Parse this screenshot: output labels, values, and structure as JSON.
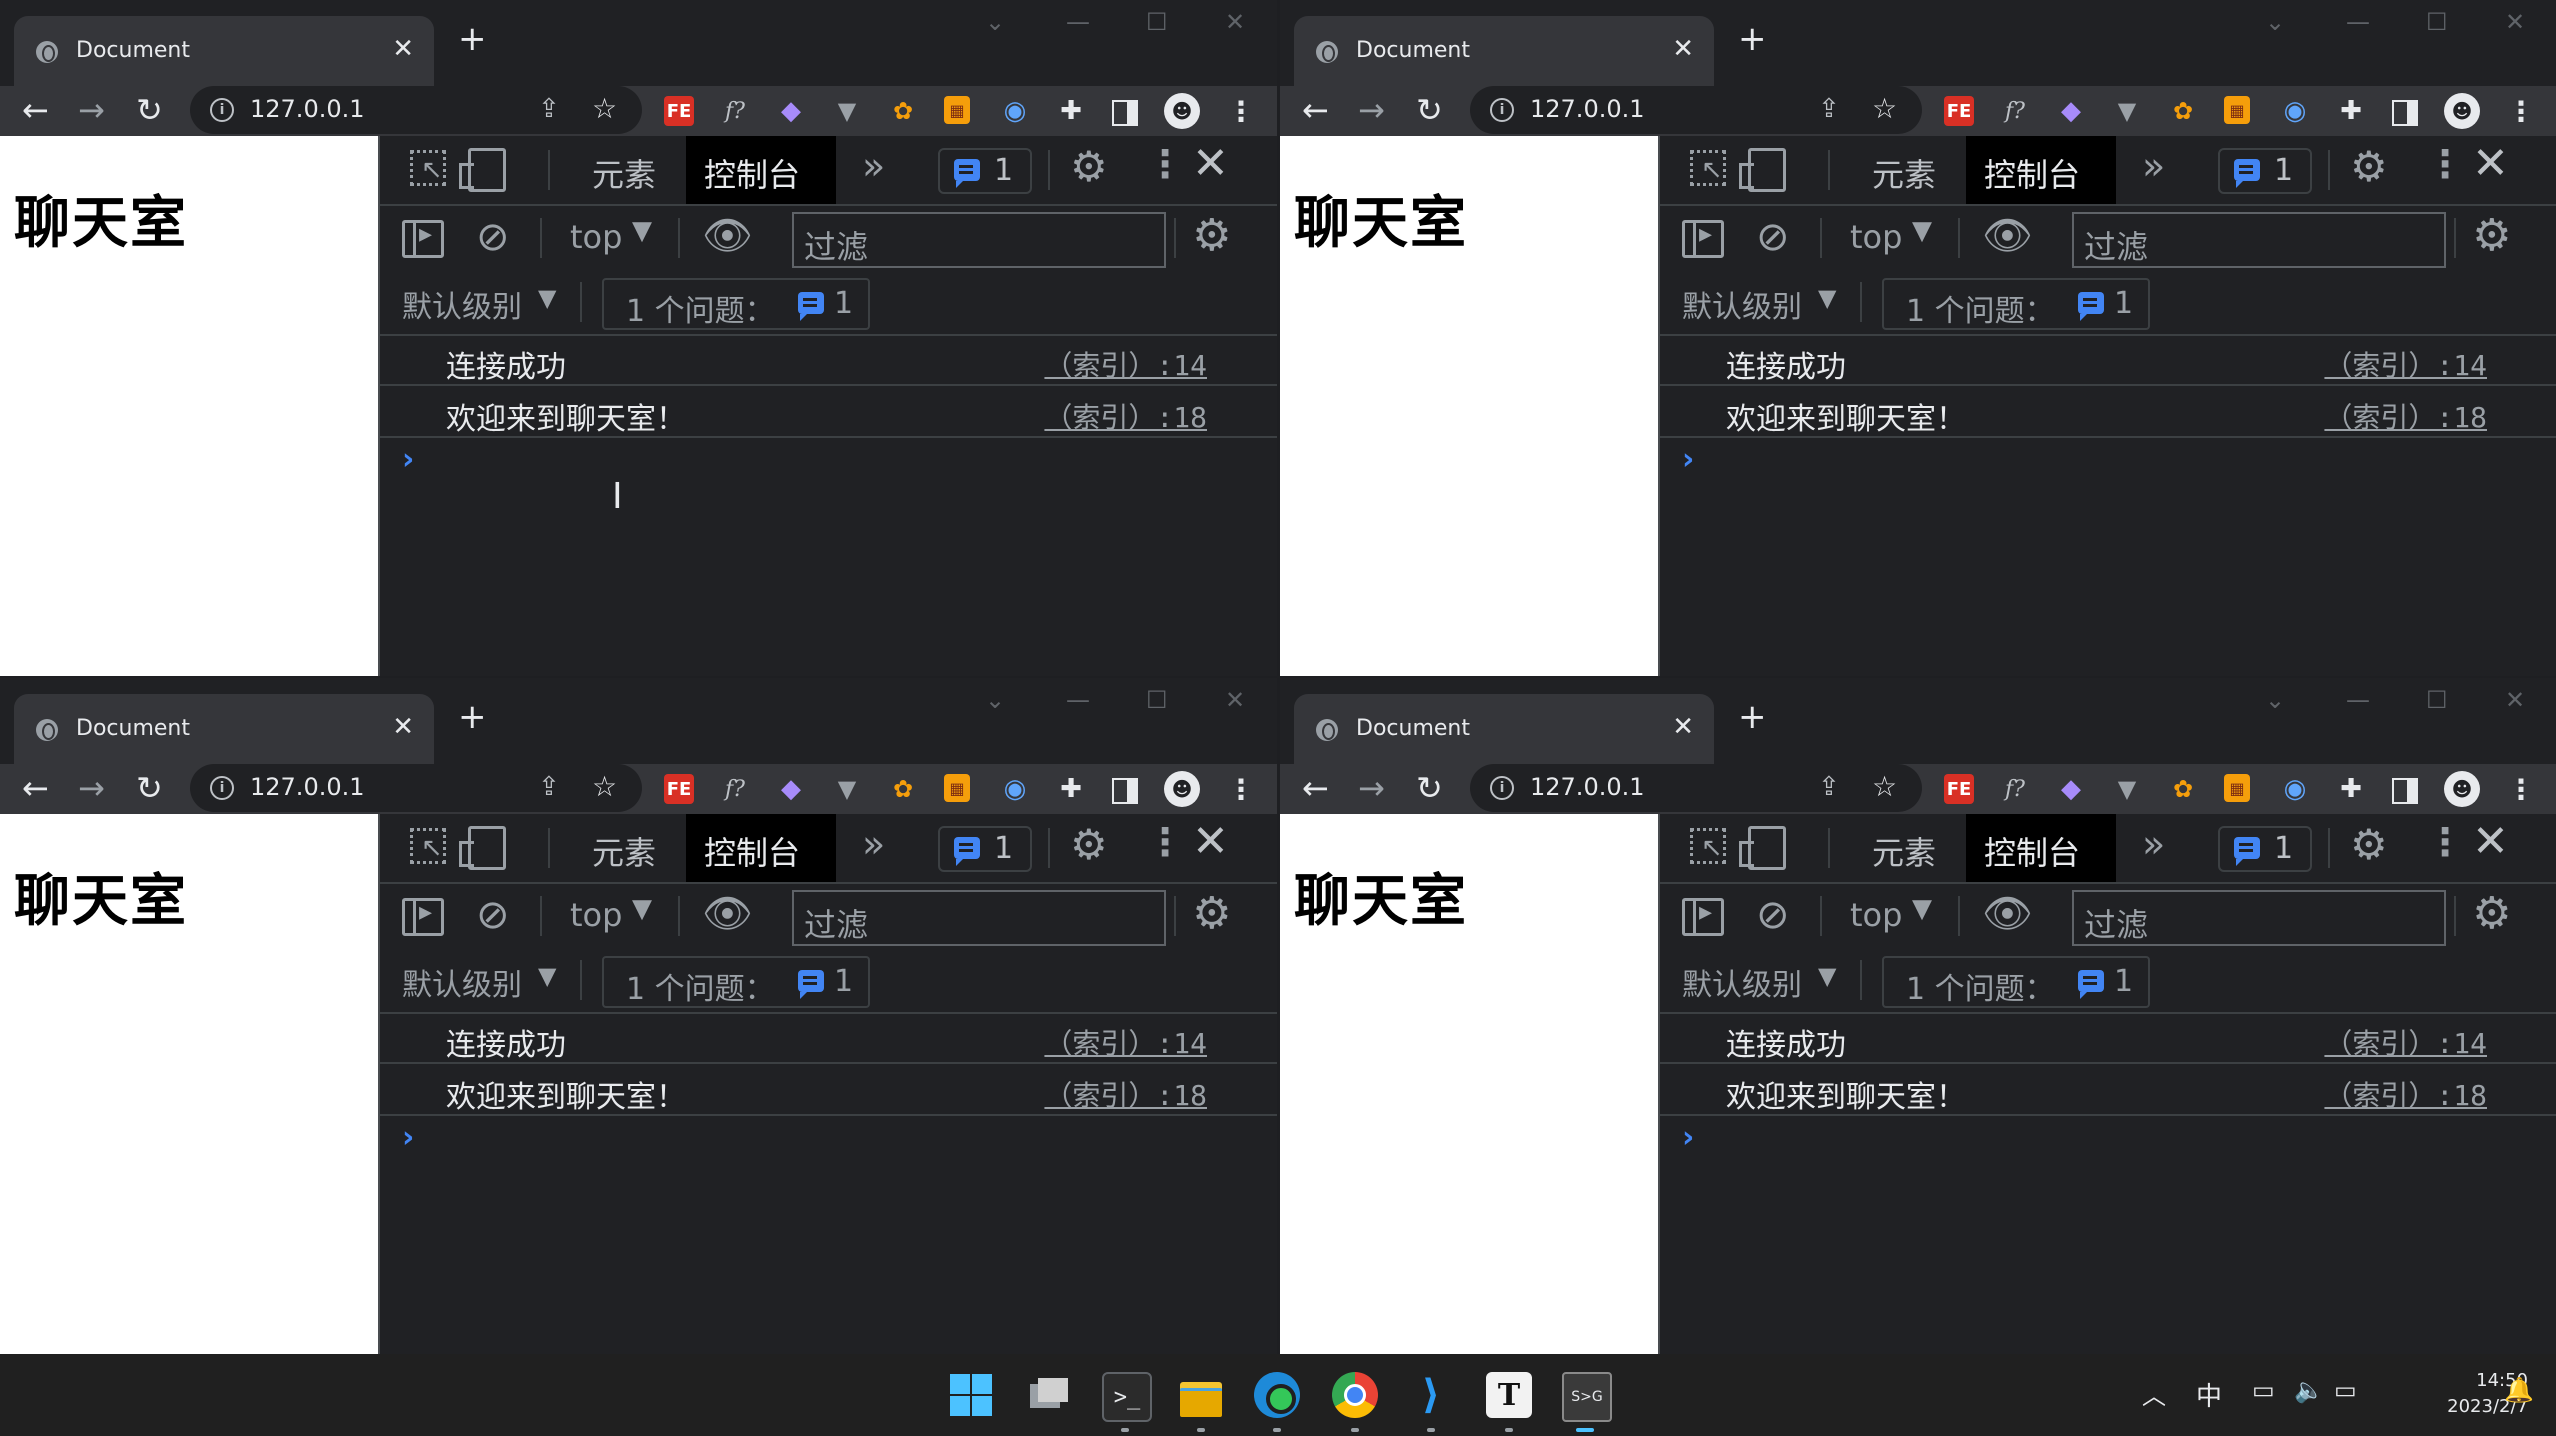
{
  "browser": {
    "tab_title": "Document",
    "tab_close": "✕",
    "new_tab": "+",
    "url": "127.0.0.1",
    "extensions": [
      "FE",
      "f?",
      "palette",
      "vue",
      "cookie",
      "calc",
      "fire",
      "puzzle",
      "sidepanel",
      "avatar",
      "menu"
    ]
  },
  "page": {
    "heading": "聊天室"
  },
  "devtools": {
    "tab_elements": "元素",
    "tab_console": "控制台",
    "more_tabs": "»",
    "issues_badge_count": "1",
    "context": "top",
    "filter_placeholder": "过滤",
    "level": "默认级别",
    "problems_label": "1 个问题：",
    "problems_count": "1",
    "logs": [
      {
        "message": "连接成功",
        "source": "（索引）:14"
      },
      {
        "message": "欢迎来到聊天室！",
        "source": "（索引）:18"
      }
    ],
    "prompt": "›"
  },
  "taskbar": {
    "terminal_label": ">_",
    "typora_label": "T",
    "snipaste_label": "S>G",
    "ime": "中",
    "time": "14:50",
    "date": "2023/2/7"
  },
  "colors": {
    "chrome_bg": "#202124",
    "chrome_toolbar": "#35363a",
    "devtools_accent": "#4285f4",
    "taskbar_bg": "#202020"
  }
}
